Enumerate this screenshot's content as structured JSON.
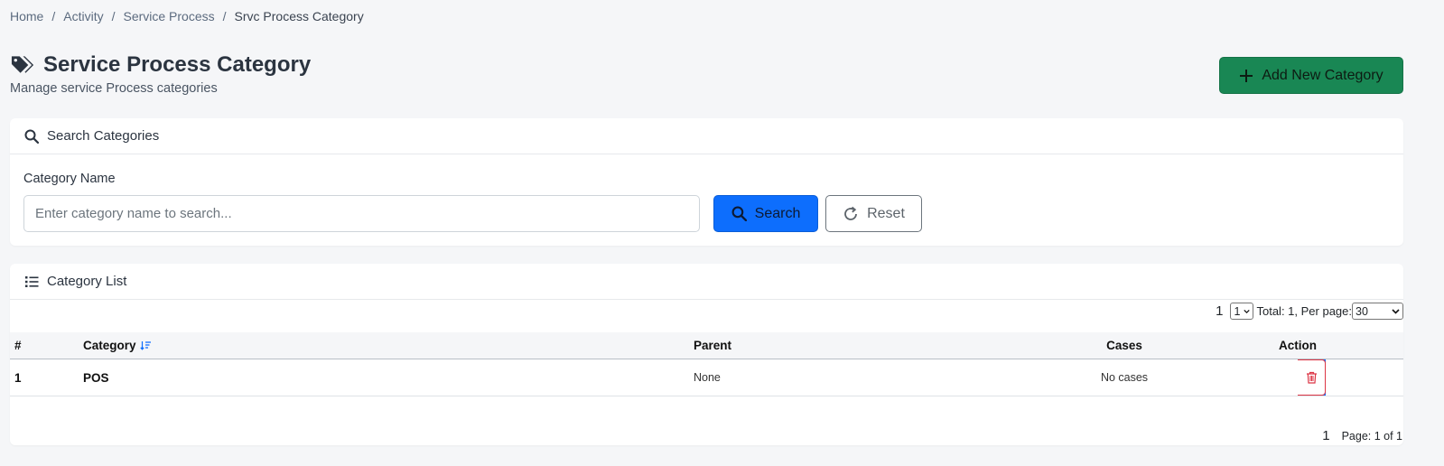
{
  "breadcrumb": {
    "items": [
      "Home",
      "Activity",
      "Service Process"
    ],
    "current": "Srvc Process Category",
    "separator": "/"
  },
  "page": {
    "title": "Service Process Category",
    "subtitle": "Manage service Process categories",
    "title_icon": "tags-icon"
  },
  "actions": {
    "add_label": "Add New Category"
  },
  "search": {
    "header": "Search Categories",
    "field_label": "Category Name",
    "placeholder": "Enter category name to search...",
    "value": "",
    "search_label": "Search",
    "reset_label": "Reset"
  },
  "list": {
    "header": "Category List",
    "pager_top": {
      "page_number": "1",
      "page_select": "1",
      "summary": "Total: 1, Per page:",
      "per_page": "30"
    },
    "columns": {
      "num": "#",
      "category": "Category",
      "parent": "Parent",
      "cases": "Cases",
      "action": "Action"
    },
    "rows": [
      {
        "num": "1",
        "category": "POS",
        "parent": "None",
        "cases": "No cases"
      }
    ],
    "pager_bottom": {
      "page_number": "1",
      "page_info": "Page: 1 of 1"
    }
  },
  "colors": {
    "success": "#198754",
    "primary": "#0d6efd",
    "danger": "#dc3545",
    "secondary": "#6c757d"
  }
}
